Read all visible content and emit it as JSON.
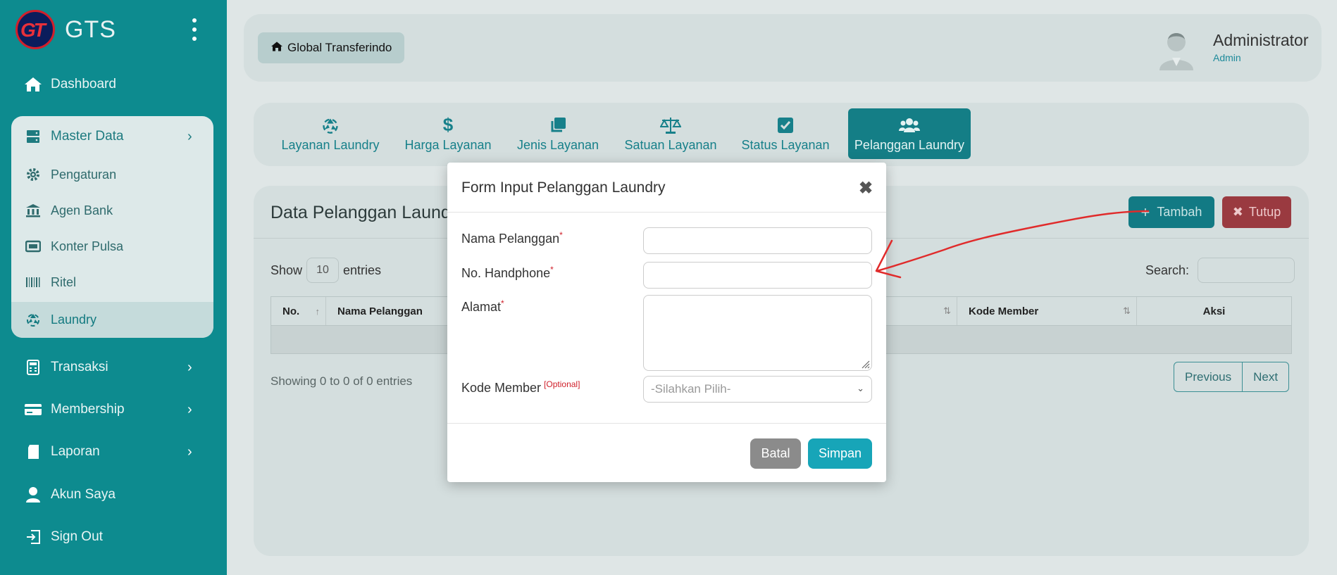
{
  "sidebar": {
    "brand": "GTS",
    "logo_text": "GT",
    "items": [
      {
        "label": "Dashboard",
        "icon": "home-icon"
      },
      {
        "label": "Master Data",
        "icon": "server-icon"
      },
      {
        "label": "Transaksi",
        "icon": "calculator-icon"
      },
      {
        "label": "Membership",
        "icon": "credit-card-icon"
      },
      {
        "label": "Laporan",
        "icon": "book-icon"
      },
      {
        "label": "Akun Saya",
        "icon": "user-icon"
      },
      {
        "label": "Sign Out",
        "icon": "sign-out-icon"
      }
    ],
    "master_sub": [
      {
        "label": "Pengaturan",
        "icon": "gear-icon"
      },
      {
        "label": "Agen Bank",
        "icon": "bank-icon"
      },
      {
        "label": "Konter Pulsa",
        "icon": "device-icon"
      },
      {
        "label": "Ritel",
        "icon": "barcode-icon"
      },
      {
        "label": "Laundry",
        "icon": "recycle-icon"
      }
    ]
  },
  "header": {
    "breadcrumb": "Global Transferindo",
    "user_name": "Administrator",
    "user_role": "Admin"
  },
  "tabs": [
    {
      "label": "Layanan Laundry",
      "icon": "recycle-icon"
    },
    {
      "label": "Harga Layanan",
      "icon": "dollar-icon"
    },
    {
      "label": "Jenis Layanan",
      "icon": "clone-icon"
    },
    {
      "label": "Satuan Layanan",
      "icon": "balance-scale-icon"
    },
    {
      "label": "Status Layanan",
      "icon": "check-square-icon"
    },
    {
      "label": "Pelanggan Laundry",
      "icon": "users-icon"
    }
  ],
  "card": {
    "title": "Data Pelanggan Laundry",
    "tambah_label": "Tambah",
    "tutup_label": "Tutup",
    "show_label": "Show",
    "entries_label": "entries",
    "page_length": "10",
    "search_label": "Search:",
    "columns": [
      "No.",
      "Nama Pelanggan",
      "Kode Member",
      "Aksi"
    ],
    "info": "Showing 0 to 0 of 0 entries",
    "prev_label": "Previous",
    "next_label": "Next"
  },
  "modal": {
    "title": "Form Input Pelanggan Laundry",
    "close_glyph": "✖",
    "fields": {
      "nama": "Nama Pelanggan",
      "hp": "No. Handphone",
      "alamat": "Alamat",
      "kode": "Kode Member"
    },
    "required_mark": "*",
    "optional_mark": "[Optional]",
    "select_placeholder": "-Silahkan Pilih-",
    "batal_label": "Batal",
    "simpan_label": "Simpan"
  },
  "colors": {
    "sidebar": "#0d8b8f",
    "accent": "#17a5b8",
    "danger": "#9a3a40",
    "annotation": "#e02b2b"
  }
}
